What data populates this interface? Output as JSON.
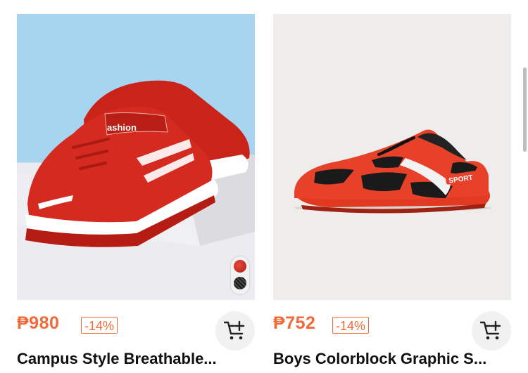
{
  "products": [
    {
      "price": "₱980",
      "discount": "-14%",
      "title": "Campus Style Breathable...",
      "image_icon": "red-velcro-sneaker-image",
      "swatches": [
        "red",
        "black"
      ],
      "shoe_text": "ashion"
    },
    {
      "price": "₱752",
      "discount": "-14%",
      "title": "Boys Colorblock Graphic S...",
      "image_icon": "red-black-soccer-turf-shoe-image",
      "shoe_text": "SPORT"
    }
  ],
  "colors": {
    "accent": "#f06a3a",
    "shoe_red": "#d42a1f",
    "title_text": "#111111"
  },
  "icons": {
    "cart": "add-to-cart-icon"
  }
}
